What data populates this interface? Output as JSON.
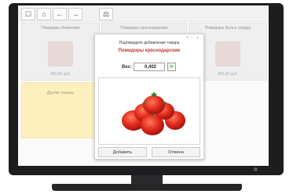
{
  "toolbar": {
    "home_icon": "home-icon",
    "back_icon": "arrow-left-icon",
    "forward_icon": "arrow-right-icon",
    "scales_icon": "scales-icon"
  },
  "tiles": [
    {
      "name": "Помидоры бакинские",
      "price": "350,00 руб."
    },
    {
      "name": "Помидоры краснодарские",
      "price": ""
    },
    {
      "name": "Помидоры Бычье сердце",
      "price": "400,00 руб."
    }
  ],
  "other_tile": {
    "name": "Другие товары"
  },
  "dialog": {
    "title": "Подтвердите добавление товара",
    "product": "Помидоры краснодарские",
    "weight_label": "Вес:",
    "weight_value": "0,402",
    "add_button": "Добавить",
    "cancel_button": "Отмена"
  },
  "colors": {
    "accent": "#c0392b",
    "other_tile": "#fde99a"
  }
}
